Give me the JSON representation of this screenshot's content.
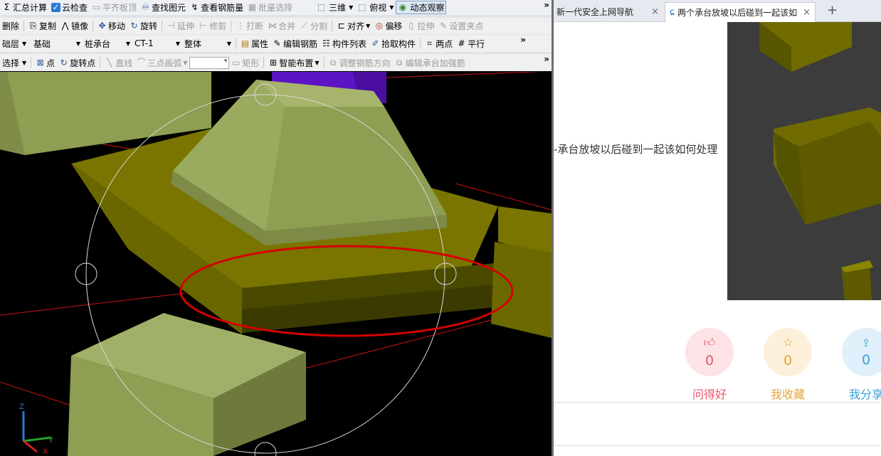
{
  "toolbar1": {
    "items": [
      {
        "icon": "sigma-icon",
        "label": "汇总计算",
        "disabled": false
      },
      {
        "icon": "cloud-check-icon",
        "label": "云检查",
        "disabled": false
      },
      {
        "icon": "level-slab-icon",
        "label": "平齐板顶",
        "disabled": true
      },
      {
        "icon": "binoculars-icon",
        "label": "查找图元",
        "disabled": false
      },
      {
        "icon": "rebar-view-icon",
        "label": "查看钢筋量",
        "disabled": false
      },
      {
        "icon": "batch-select-icon",
        "label": "批量选择",
        "disabled": true
      }
    ],
    "view_mode": "三维",
    "view_angle": "俯视",
    "dynamic_observe": "动态观察",
    "more": "»"
  },
  "toolbar2": {
    "items": [
      {
        "icon": "delete-icon",
        "label": "删除",
        "disabled": false
      },
      {
        "icon": "copy-icon",
        "label": "复制",
        "disabled": false
      },
      {
        "icon": "mirror-icon",
        "label": "镜像",
        "disabled": false
      },
      {
        "icon": "move-icon",
        "label": "移动",
        "disabled": false
      },
      {
        "icon": "rotate-icon",
        "label": "旋转",
        "disabled": false
      },
      {
        "icon": "extend-icon",
        "label": "延伸",
        "disabled": true
      },
      {
        "icon": "trim-icon",
        "label": "修剪",
        "disabled": true
      },
      {
        "icon": "break-icon",
        "label": "打断",
        "disabled": true
      },
      {
        "icon": "merge-icon",
        "label": "合并",
        "disabled": true
      },
      {
        "icon": "split-icon",
        "label": "分割",
        "disabled": true
      },
      {
        "icon": "align-icon",
        "label": "对齐",
        "disabled": false
      },
      {
        "icon": "offset-icon",
        "label": "偏移",
        "disabled": false
      },
      {
        "icon": "stretch-icon",
        "label": "拉伸",
        "disabled": true
      },
      {
        "icon": "grip-icon",
        "label": "设置夹点",
        "disabled": true
      }
    ]
  },
  "toolbar3": {
    "layer": "础层",
    "category": "基础",
    "component_type": "桩承台",
    "component_name": "CT-1",
    "scope": "整体",
    "properties": "属性",
    "edit_rebar": "编辑钢筋",
    "component_list": "构件列表",
    "pick_component": "拾取构件",
    "two_points": "两点",
    "parallel": "平行",
    "more": "»"
  },
  "toolbar4": {
    "select": "选择",
    "point": "点",
    "rotate_point": "旋转点",
    "line": "直线",
    "arc": "三点画弧",
    "rect": "矩形",
    "smart_layout": "智能布置",
    "adjust_rebar": "调整钢筋方向",
    "edit_cap_rebar": "编辑承台加强筋",
    "more": "»"
  },
  "axes": {
    "z": "Z",
    "y": "Y",
    "x": "X"
  },
  "colors": {
    "highlight": "#d40000",
    "cap_dark": "#7a7500",
    "cap_light": "#8e9e52",
    "column": "#6010c0"
  },
  "browser": {
    "tabs": [
      {
        "title": "新一代安全上网导航",
        "active": false
      },
      {
        "title": "两个承台放坡以后碰到一起该如何处理",
        "active": true
      }
    ],
    "question_title": "-承台放坡以后碰到一起该如何处理",
    "actions": [
      {
        "icon": "thumbs-up-icon",
        "count": "0",
        "label": "问得好",
        "color": "#e8566b",
        "bg": "#fde3e6"
      },
      {
        "icon": "star-icon",
        "count": "0",
        "label": "我收藏",
        "color": "#e3a53b",
        "bg": "#fdf0da"
      },
      {
        "icon": "share-icon",
        "count": "0",
        "label": "我分享",
        "color": "#3b9fd6",
        "bg": "#dff0fa"
      }
    ]
  }
}
